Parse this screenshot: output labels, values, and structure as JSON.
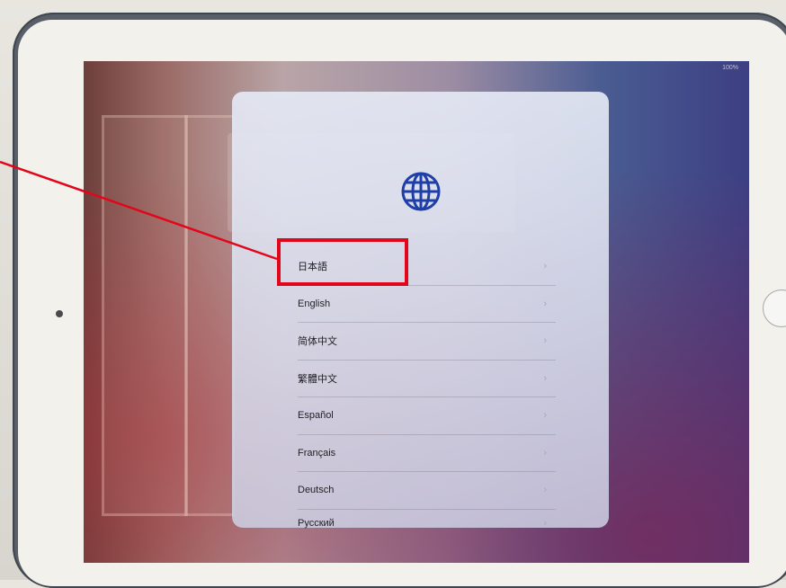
{
  "status_bar": {
    "battery": "100%"
  },
  "setup": {
    "languages": [
      {
        "label": "日本語"
      },
      {
        "label": "English"
      },
      {
        "label": "简体中文"
      },
      {
        "label": "繁體中文"
      },
      {
        "label": "Español"
      },
      {
        "label": "Français"
      },
      {
        "label": "Deutsch"
      },
      {
        "label": "Русский"
      }
    ],
    "chevron": "›",
    "globe_color": "#1f3fa8"
  },
  "annotation": {
    "highlight_color": "#e3061b"
  }
}
